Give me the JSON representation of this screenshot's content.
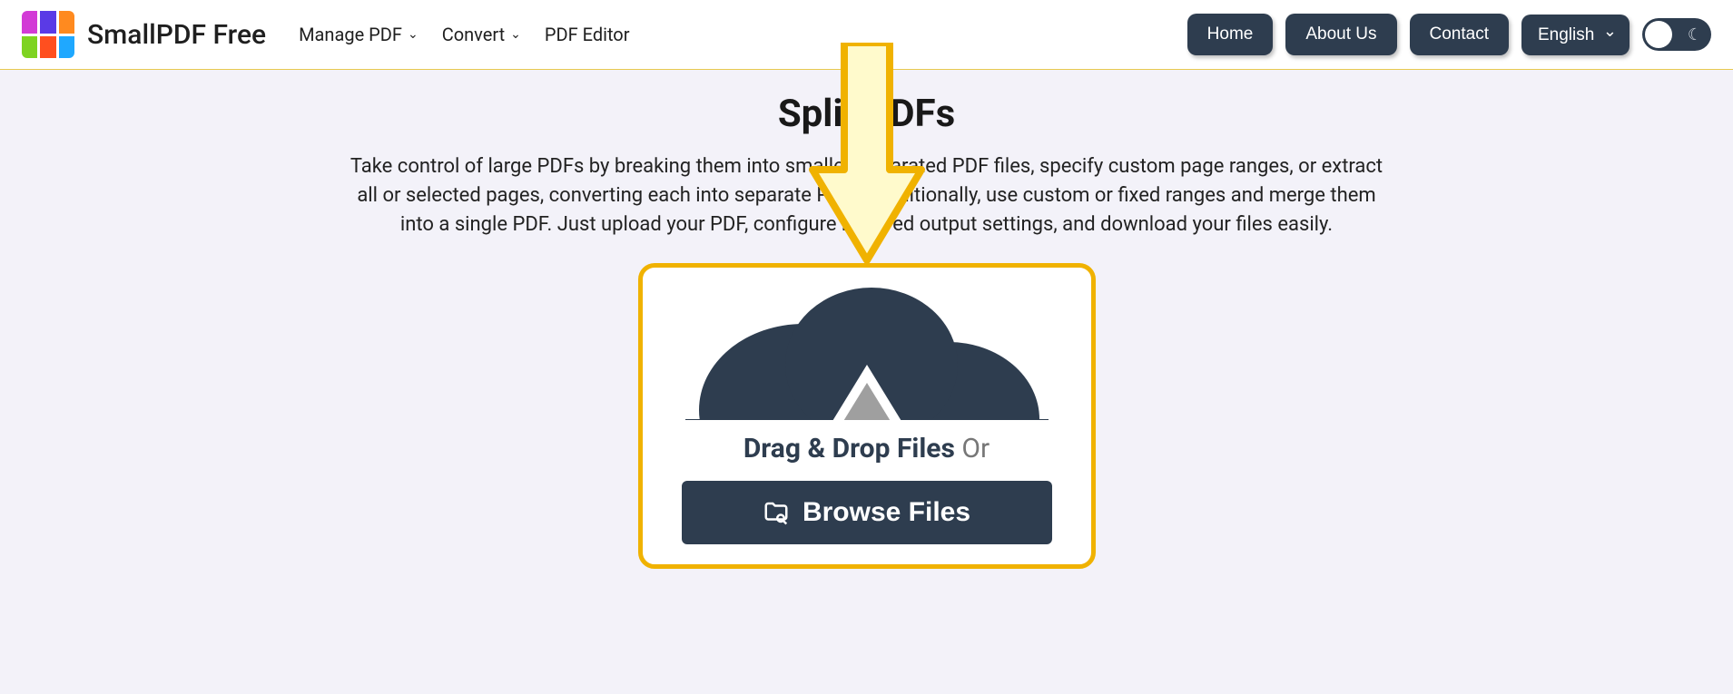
{
  "brand": "SmallPDF Free",
  "nav": {
    "manage": "Manage PDF",
    "convert": "Convert",
    "editor": "PDF Editor"
  },
  "buttons": {
    "home": "Home",
    "about": "About Us",
    "contact": "Contact"
  },
  "language": "English",
  "page": {
    "title": "Split PDFs",
    "description": "Take control of large PDFs by breaking them into smaller, separated PDF files, specify custom page ranges, or extract all or selected pages, converting each into separate PDFs. Additionally, use custom or fixed ranges and merge them into a single PDF. Just upload your PDF, configure required output settings, and download your files easily."
  },
  "upload": {
    "drag_label": "Drag & Drop Files",
    "or": "Or",
    "browse": "Browse Files"
  },
  "logo_colors": [
    "#d23ad6",
    "#5a3ae6",
    "#ff8a1f",
    "#7ed321",
    "#ff4f1f",
    "#1fa8ff"
  ]
}
